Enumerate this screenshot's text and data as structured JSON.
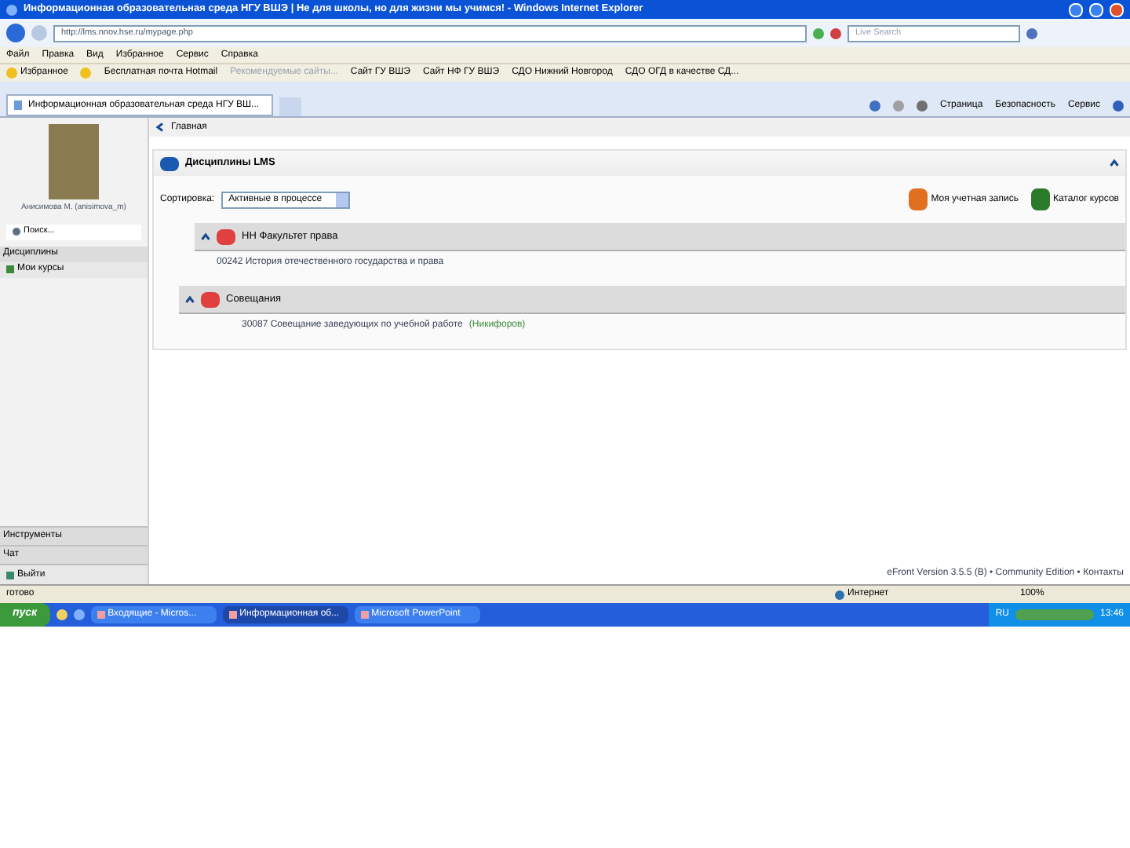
{
  "window": {
    "title": "Информационная образовательная среда НГУ ВШЭ | Не для школы, но для жизни мы учимся! - Windows Internet Explorer"
  },
  "address_bar": {
    "value": "http://lms.nnov.hse.ru/mypage.php",
    "search_placeholder": "Live Search"
  },
  "menu": [
    "Файл",
    "Правка",
    "Вид",
    "Избранное",
    "Сервис",
    "Справка"
  ],
  "favorites_bar": {
    "label": "Избранное",
    "links": [
      {
        "text": "Бесплатная почта Hotmail",
        "disabled": false
      },
      {
        "text": "Рекомендуемые сайты...",
        "disabled": true
      },
      {
        "text": "Сайт ГУ ВШЭ",
        "disabled": false
      },
      {
        "text": "Сайт НФ ГУ ВШЭ",
        "disabled": false
      },
      {
        "text": "СДО Нижний Новгород",
        "disabled": false
      },
      {
        "text": "СДО ОГД в качестве СД...",
        "disabled": false
      }
    ]
  },
  "tab": {
    "label": "Информационная образовательная среда НГУ ВШ...",
    "selected": true
  },
  "command_bar": [
    "Страница",
    "Безопасность",
    "Сервис"
  ],
  "sidebar": {
    "user": "Анисимова М. (anisimova_m)",
    "search_placeholder": "Поиск...",
    "sections_top": [
      {
        "title": "Дисциплины",
        "items": [
          "Мои курсы"
        ]
      }
    ],
    "sections_bottom": [
      "Инструменты",
      "Чат"
    ],
    "logout": "Выйти"
  },
  "breadcrumb": "Главная",
  "panel": {
    "title": "Дисциплины LMS",
    "sort_label": "Сортировка:",
    "sort_value": "Активные в процессе",
    "links": [
      "Моя учетная запись",
      "Каталог курсов"
    ],
    "groups": [
      {
        "title": "НН Факультет права",
        "courses": [
          {
            "text": "00242 История отечественного государства и права"
          }
        ]
      },
      {
        "title": "Совещания",
        "courses": [
          {
            "text": "30087 Совещание заведующих по учебной работе",
            "note": "(Никифоров)"
          }
        ]
      }
    ]
  },
  "footer": "eFront Version 3.5.5 (B) • Community Edition • Контакты",
  "status_bar": {
    "text": "готово",
    "zone": "Интернет",
    "zoom": "100%"
  },
  "taskbar": {
    "start": "пуск",
    "tasks": [
      {
        "label": "Входящие - Micros...",
        "selected": false
      },
      {
        "label": "Информационная об...",
        "selected": true
      },
      {
        "label": "Microsoft PowerPoint",
        "selected": false
      }
    ],
    "language": "RU",
    "time": "13:46"
  }
}
